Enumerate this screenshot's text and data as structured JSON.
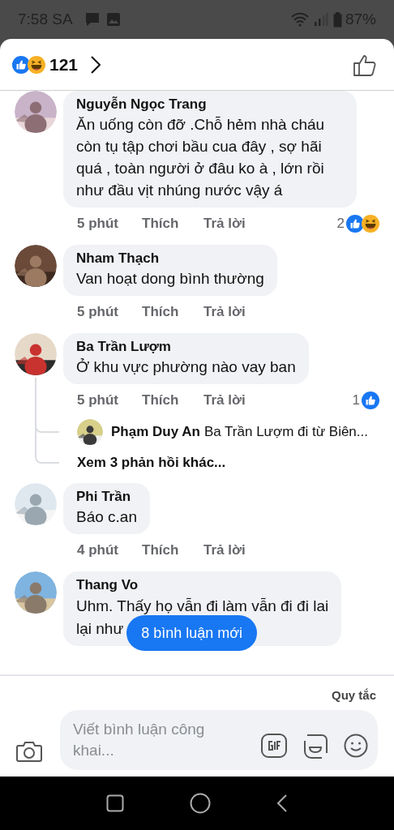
{
  "status_bar": {
    "time": "7:58 SA",
    "battery": "87%"
  },
  "header": {
    "reaction_count": "121",
    "reactions": {
      "like": true,
      "haha": true
    }
  },
  "comments": [
    {
      "name": "Nguyễn Ngọc Trang",
      "text": "Ăn uống còn đỡ .Chỗ hẻm nhà cháu còn tụ tập chơi bầu cua đây , sợ hãi quá , toàn người ở đâu ko à , lớn rồi như đầu vịt nhúng nước vậy á",
      "time": "5 phút",
      "like": "Thích",
      "reply": "Trả lời",
      "reaction_count": "2",
      "reactions": {
        "like": true,
        "haha": true
      }
    },
    {
      "name": "Nham Thạch",
      "text": "Van hoạt dong bình thường",
      "time": "5 phút",
      "like": "Thích",
      "reply": "Trả lời"
    },
    {
      "name": "Ba Trần Lượm",
      "text": "Ở khu vực phường nào vay ban",
      "time": "5 phút",
      "like": "Thích",
      "reply": "Trả lời",
      "reaction_count": "1",
      "reactions": {
        "like": true,
        "haha": false
      },
      "replies": {
        "preview_name": "Phạm Duy An",
        "preview_text": "Ba Trần Lượm đi từ Biên...",
        "more": "Xem 3 phản hồi khác..."
      }
    },
    {
      "name": "Phi Trần",
      "text": "Báo c.an",
      "time": "4 phút",
      "like": "Thích",
      "reply": "Trả lời"
    },
    {
      "name": "Thang Vo",
      "text_lines": [
        "Uhm. Thấy họ vẫn đi làm vẫn đi đi lai",
        "lại như"
      ]
    }
  ],
  "new_comments_button": "8 bình luận mới",
  "rules_link": "Quy tắc",
  "composer": {
    "placeholder": "Viết bình luận công khai..."
  }
}
